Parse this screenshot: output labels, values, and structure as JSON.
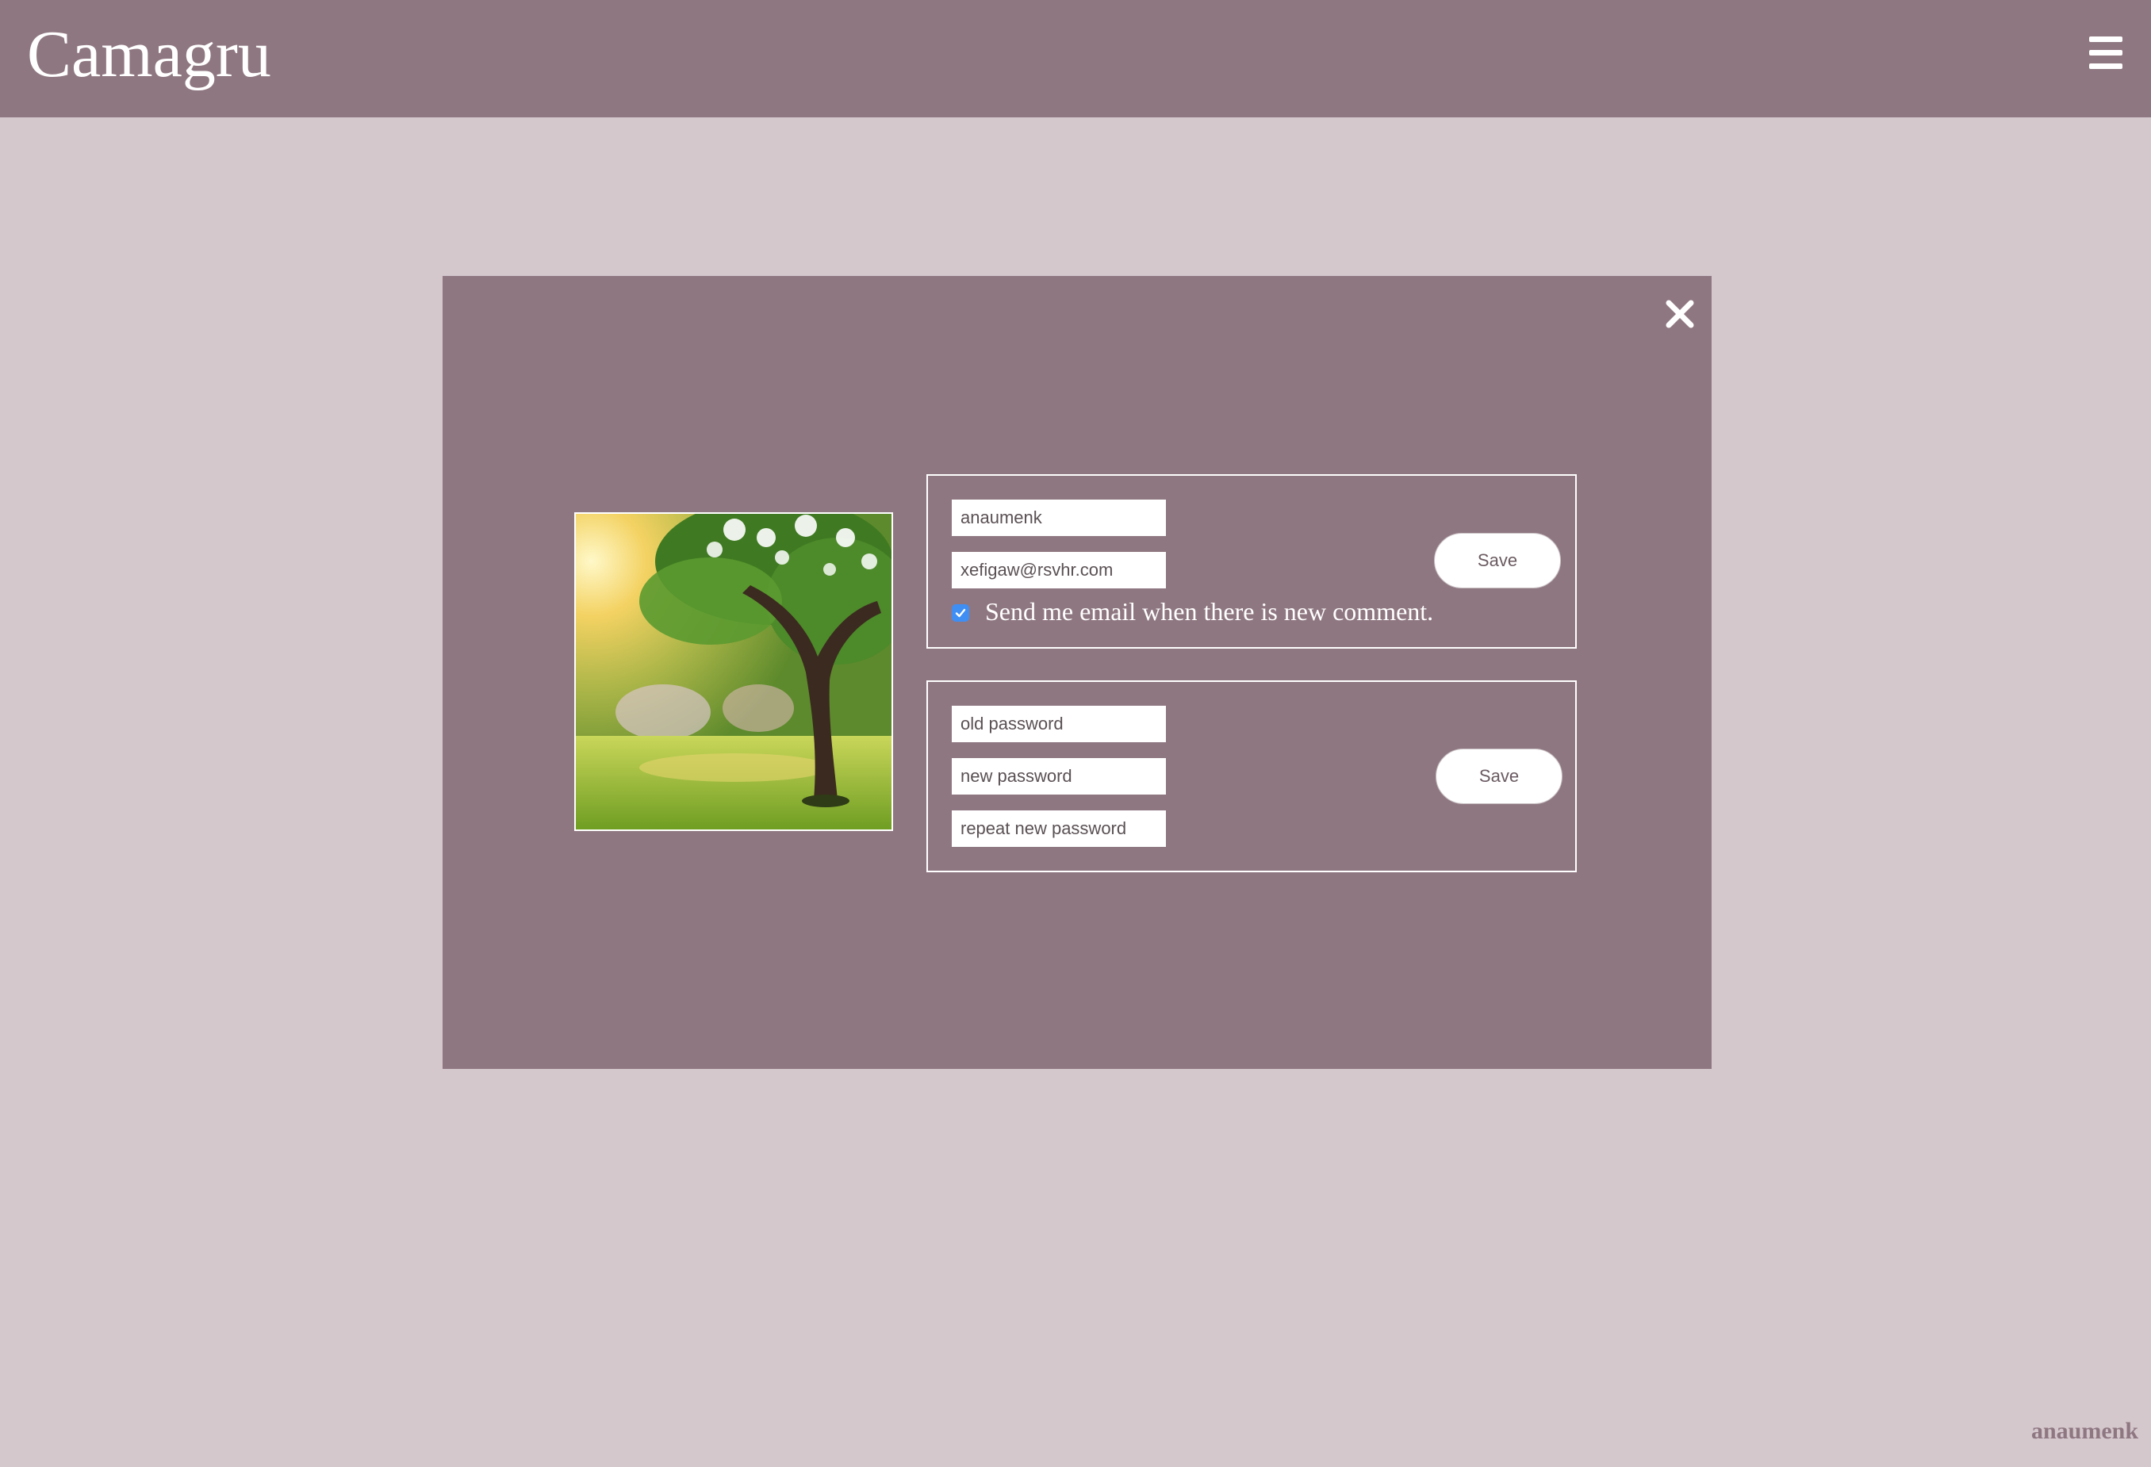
{
  "header": {
    "brand": "Camagru",
    "menu_icon": "hamburger-menu-icon"
  },
  "modal": {
    "close_icon": "close-x-icon",
    "avatar_alt": "profile picture",
    "profile": {
      "username_value": "anaumenk",
      "email_value": "xefigaw@rsvhr.com",
      "notify_checked": true,
      "notify_label": "Send me email when there is new comment.",
      "save_label": "Save"
    },
    "password": {
      "old_placeholder": "old password",
      "new_placeholder": "new password",
      "repeat_placeholder": "repeat new password",
      "save_label": "Save"
    }
  },
  "footer": {
    "username": "anaumenk"
  },
  "colors": {
    "accent": "#8f7781",
    "background": "#d4c8cd",
    "checkbox": "#3f8ef4"
  }
}
